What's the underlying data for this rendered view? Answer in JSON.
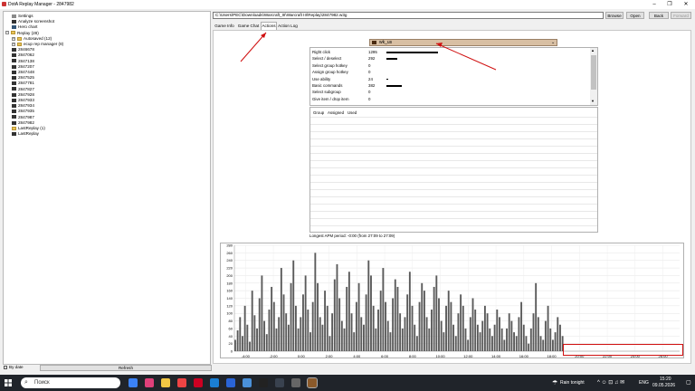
{
  "window": {
    "title": "DotA Replay Manager - 2847982",
    "minimize": "–",
    "restore": "❐",
    "close": "✕"
  },
  "tree": {
    "items": [
      {
        "label": "Settings",
        "icon": "settings-icon",
        "level": 1
      },
      {
        "label": "Analyze screenshot",
        "icon": "file-icon",
        "level": 1
      },
      {
        "label": "Hero chart",
        "icon": "hero-icon",
        "level": 1
      },
      {
        "label": "Replay (28)",
        "icon": "folder-icon",
        "level": 0,
        "expander": "−"
      },
      {
        "label": "Autosaved (12)",
        "icon": "folder-icon",
        "level": 1,
        "expander": "+"
      },
      {
        "label": "ecup rep manager (8)",
        "icon": "folder-icon",
        "level": 1,
        "expander": "+"
      },
      {
        "label": "2846678",
        "icon": "file-icon",
        "level": 1
      },
      {
        "label": "2847062",
        "icon": "file-icon",
        "level": 1
      },
      {
        "label": "2847138",
        "icon": "file-icon",
        "level": 1
      },
      {
        "label": "2847207",
        "icon": "file-icon",
        "level": 1
      },
      {
        "label": "2847448",
        "icon": "file-icon",
        "level": 1
      },
      {
        "label": "2847525",
        "icon": "file-icon",
        "level": 1
      },
      {
        "label": "2847781",
        "icon": "file-icon",
        "level": 1
      },
      {
        "label": "2847827",
        "icon": "file-icon",
        "level": 1
      },
      {
        "label": "2847928",
        "icon": "file-icon",
        "level": 1
      },
      {
        "label": "2847933",
        "icon": "file-icon",
        "level": 1
      },
      {
        "label": "2847934",
        "icon": "file-icon",
        "level": 1
      },
      {
        "label": "2847935",
        "icon": "file-icon",
        "level": 1
      },
      {
        "label": "2847987",
        "icon": "file-icon",
        "level": 1
      },
      {
        "label": "2847982",
        "icon": "file-icon",
        "level": 1
      },
      {
        "label": "LastReplay (1)",
        "icon": "folder-icon",
        "level": 1
      },
      {
        "label": "LastReplay",
        "icon": "file-icon",
        "level": 1
      }
    ],
    "by_date": "By date",
    "refresh": "Refresh"
  },
  "toolbar": {
    "path": "C:\\Users\\РЕС\\Downloads\\Warcraft_III\\Warcraft III\\Replay\\2847982.w3g",
    "browse": "Browse",
    "open": "Open",
    "back": "Back",
    "forward": "Forward"
  },
  "tabs": [
    "Game Info",
    "Game Chat",
    "Actions",
    "Action Log"
  ],
  "player": {
    "name": "wk_us",
    "color": "#4a2a10"
  },
  "stats": [
    {
      "label": "Right click",
      "value": "1295",
      "bar": 0.95
    },
    {
      "label": "Select / deselect",
      "value": "292",
      "bar": 0.2
    },
    {
      "label": "Select group hotkey",
      "value": "0",
      "bar": 0
    },
    {
      "label": "Assign group hotkey",
      "value": "0",
      "bar": 0
    },
    {
      "label": "Use ability",
      "value": "24",
      "bar": 0.02
    },
    {
      "label": "Basic commands",
      "value": "382",
      "bar": 0.28
    },
    {
      "label": "Select subgroup",
      "value": "0",
      "bar": 0
    },
    {
      "label": "Give item / drop item",
      "value": "0",
      "bar": 0
    }
  ],
  "groups_headers": [
    "Group",
    "Assigned",
    "Used"
  ],
  "apm_period": "Longest APM period: -0:00 (from 27:09 to 27:09)",
  "chart_data": {
    "type": "bar",
    "ylim": [
      0,
      280
    ],
    "y_ticks": [
      "0",
      "20",
      "40",
      "60",
      "80",
      "100",
      "120",
      "140",
      "160",
      "180",
      "200",
      "220",
      "240",
      "260",
      "280"
    ],
    "x_ticks": [
      "-4:00",
      "-2:00",
      "0:00",
      "2:00",
      "4:00",
      "6:00",
      "8:00",
      "10:00",
      "12:00",
      "14:00",
      "16:00",
      "18:00",
      "20:00",
      "22:00",
      "24:00",
      "26:00"
    ],
    "x_start_min": -4.8,
    "x_end_min": 27.2,
    "data_end_min": 18.9,
    "values": [
      30,
      55,
      90,
      40,
      120,
      70,
      25,
      160,
      95,
      60,
      140,
      200,
      80,
      45,
      110,
      170,
      130,
      60,
      90,
      220,
      150,
      100,
      70,
      180,
      240,
      120,
      60,
      90,
      150,
      200,
      110,
      50,
      130,
      260,
      180,
      90,
      70,
      160,
      120,
      40,
      100,
      190,
      230,
      140,
      80,
      60,
      170,
      210,
      100,
      50,
      130,
      180,
      90,
      70,
      150,
      240,
      200,
      120,
      60,
      110,
      160,
      220,
      130,
      80,
      50,
      140,
      190,
      170,
      100,
      60,
      90,
      150,
      210,
      120,
      70,
      40,
      130,
      180,
      160,
      90,
      60,
      110,
      170,
      200,
      140,
      80,
      50,
      120,
      160,
      130,
      70,
      40,
      100,
      150,
      120,
      60,
      30,
      90,
      140,
      110,
      70,
      50,
      80,
      120,
      100,
      60,
      40,
      70,
      110,
      90,
      60,
      30,
      60,
      100,
      80,
      50,
      40,
      90,
      130,
      70,
      40,
      20,
      60,
      100,
      180,
      90,
      40,
      30,
      80,
      120,
      60,
      30,
      50,
      90,
      70,
      40
    ]
  },
  "taskbar": {
    "search": "Поиск",
    "weather": "Rain tonight",
    "lang": "ENG",
    "time": "15:20",
    "date": "09.05.2026"
  }
}
